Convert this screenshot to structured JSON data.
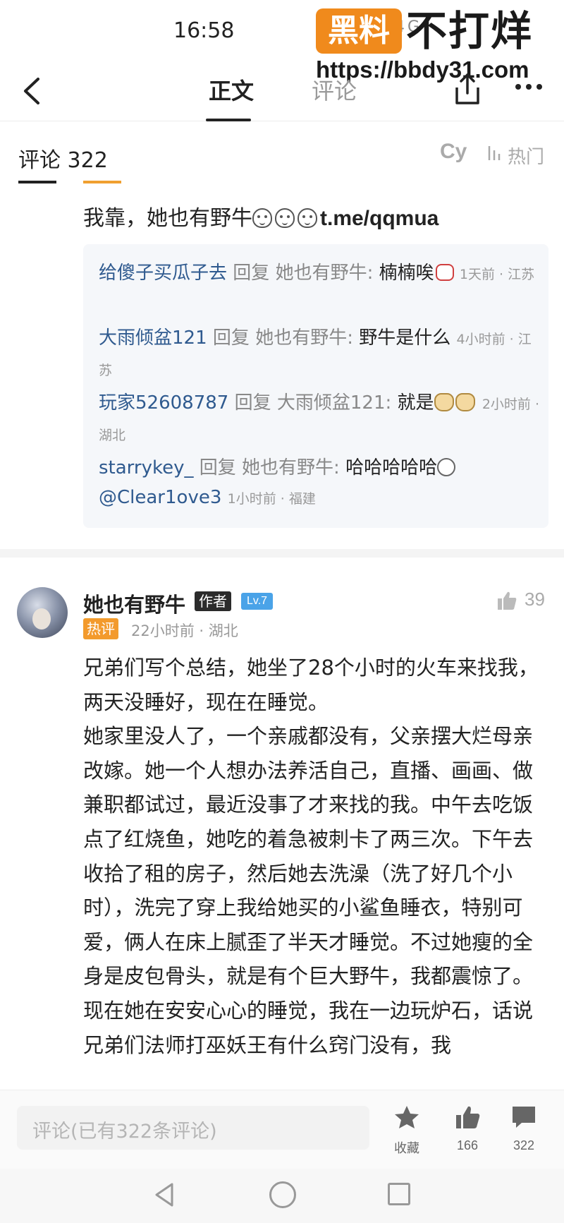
{
  "status_bar": {
    "time": "16:58",
    "icons": "4G"
  },
  "watermark": {
    "badge": "黑料",
    "title": "不打烊",
    "url": "https://bbdy31.com"
  },
  "nav": {
    "tab_body": "正文",
    "tab_comments": "评论"
  },
  "comments_header": {
    "label": "评论 322",
    "cy": "Cy",
    "sort": "热门"
  },
  "first_comment": {
    "text": "我靠，她也有野牛",
    "link": "t.me/qqmua"
  },
  "replies": [
    {
      "name": "给傻子买瓜子去",
      "verb": "回复",
      "target": "她也有野牛:",
      "content": "楠楠唉",
      "meta": "1天前 · 江苏"
    },
    {
      "name": "大雨倾盆121",
      "verb": "回复",
      "target": "她也有野牛:",
      "content": "野牛是什么",
      "meta": "4小时前 · 江苏"
    },
    {
      "name": "玩家52608787",
      "verb": "回复",
      "target": "大雨倾盆121:",
      "content": "就是",
      "meta": "2小时前 · 湖北"
    },
    {
      "name": "starrykey_",
      "verb": "回复",
      "target": "她也有野牛:",
      "content": "哈哈哈哈哈",
      "mention": "@Clear1ove3",
      "meta": "1小时前 · 福建"
    }
  ],
  "main_comment": {
    "author": "她也有野牛",
    "author_badge": "作者",
    "level": "Lv.7",
    "likes": "39",
    "hot_badge": "热评",
    "meta": "22小时前 · 湖北",
    "paragraphs": [
      "兄弟们写个总结，她坐了28个小时的火车来找我，两天没睡好，现在在睡觉。",
      "她家里没人了，一个亲戚都没有，父亲摆大烂母亲改嫁。她一个人想办法养活自己，直播、画画、做兼职都试过，最近没事了才来找的我。中午去吃饭点了红烧鱼，她吃的着急被刺卡了两三次。下午去收拾了租的房子，然后她去洗澡（洗了好几个小时），洗完了穿上我给她买的小鲨鱼睡衣，特别可爱，俩人在床上腻歪了半天才睡觉。不过她瘦的全身是皮包骨头，就是有个巨大野牛，我都震惊了。",
      "现在她在安安心心的睡觉，我在一边玩炉石，话说兄弟们法师打巫妖王有什么窍门没有，我"
    ]
  },
  "bottom_bar": {
    "input_placeholder": "评论(已有322条评论)",
    "collect_label": "收藏",
    "like_count": "166",
    "comment_count": "322"
  }
}
